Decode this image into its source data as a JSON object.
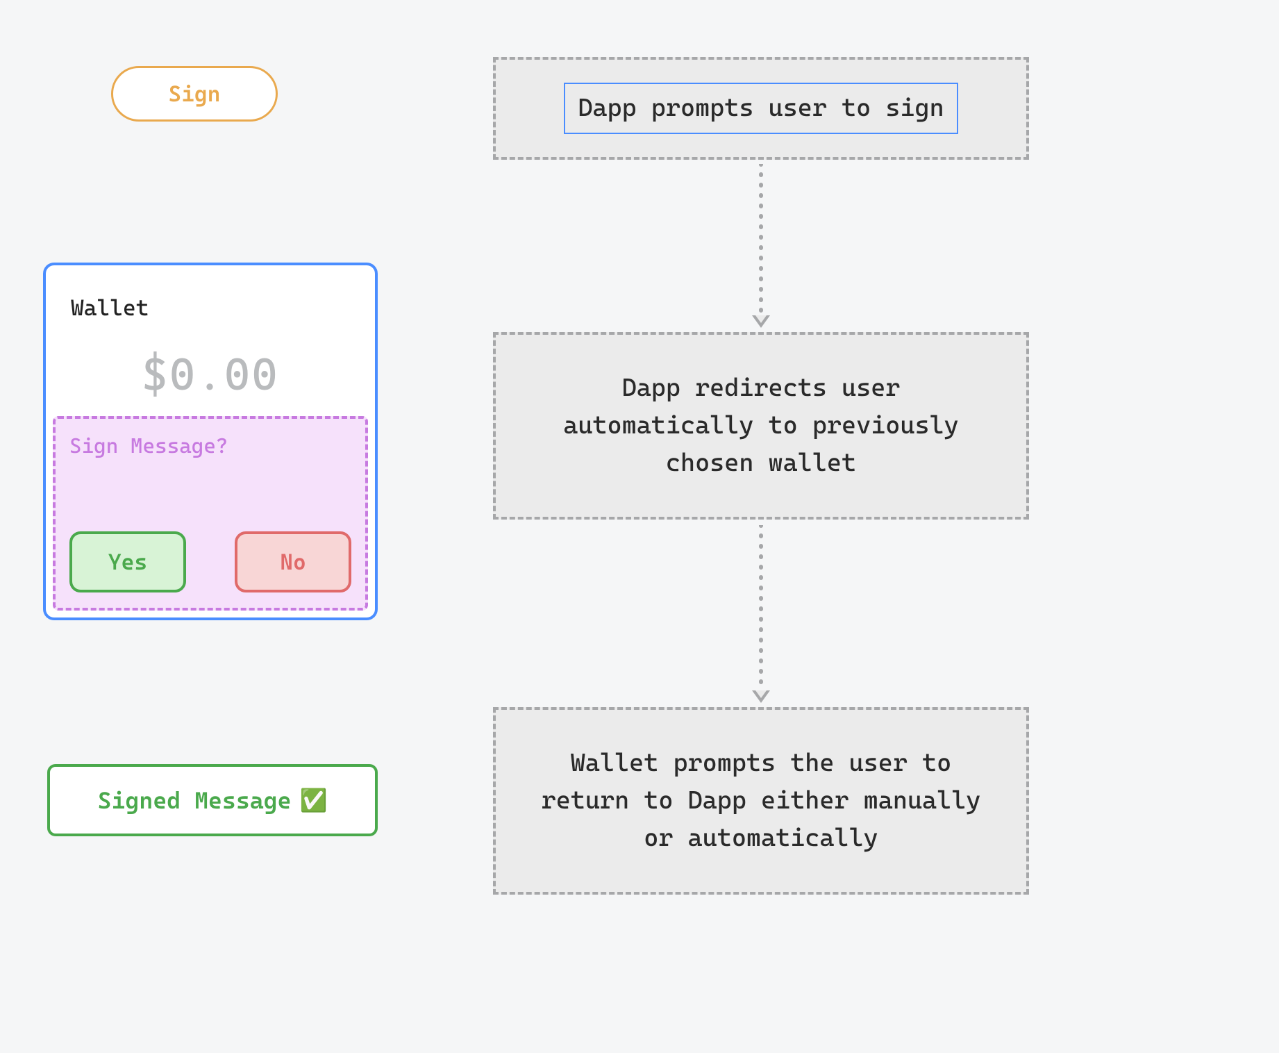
{
  "left": {
    "sign_button_label": "Sign",
    "wallet": {
      "title": "Wallet",
      "balance": "$0.00",
      "sign_prompt": "Sign Message?",
      "yes_label": "Yes",
      "no_label": "No"
    },
    "signed_message_label": "Signed Message",
    "signed_message_icon": "✅"
  },
  "flow": {
    "step1": "Dapp prompts user to sign",
    "step2": "Dapp redirects user automatically to previously chosen wallet",
    "step3": "Wallet prompts the user to return to Dapp either manually or automatically"
  },
  "colors": {
    "orange": "#e9a94e",
    "blue": "#4a8dff",
    "purple": "#c77ae0",
    "green": "#4aa94c",
    "red": "#e06a6a",
    "gray_border": "#a6a7a9",
    "gray_fill": "#ebebeb"
  }
}
